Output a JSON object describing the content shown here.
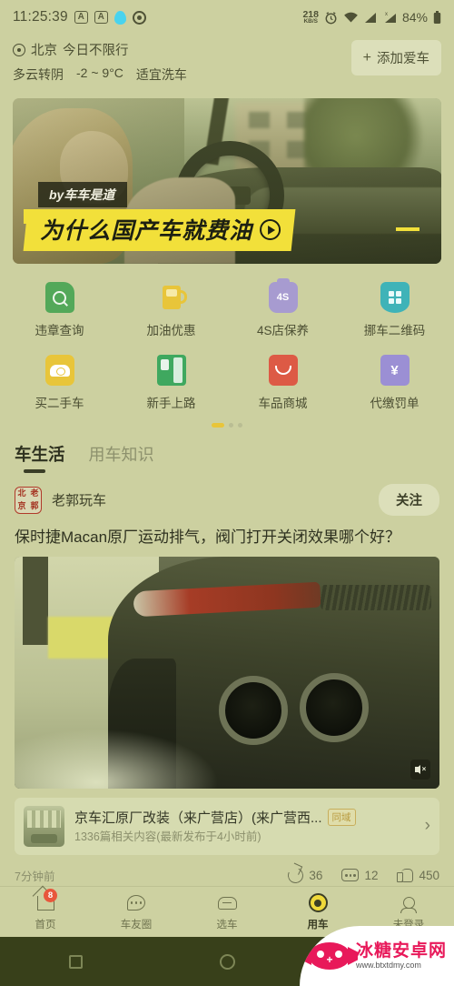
{
  "status_bar": {
    "time": "11:25:39",
    "icons": [
      "android-a-icon",
      "android-a-icon",
      "qq-penguin-icon",
      "target-icon"
    ],
    "net_speed_value": "218",
    "net_speed_unit": "KB/S",
    "alarm_icon": "alarm-icon",
    "wifi_icon": "wifi-icon",
    "signal_icon_1": "signal-bars-icon",
    "signal_icon_2": "signal-bars-x-icon",
    "battery_percent": "84%",
    "battery_icon": "battery-icon"
  },
  "header": {
    "location_icon": "location-pin-icon",
    "city": "北京",
    "restriction": "今日不限行",
    "weather": "多云转阴",
    "temperature": "-2 ~ 9°C",
    "wash_advice": "适宜洗车",
    "add_car_label": "添加爱车",
    "add_car_plus": "+"
  },
  "hero": {
    "byline": "by车车是道",
    "title": "为什么国产车就费油",
    "play_icon": "play-circle-icon"
  },
  "grid": {
    "items": [
      {
        "label": "违章查询",
        "icon": "violation-search-icon",
        "color": "#53a859"
      },
      {
        "label": "加油优惠",
        "icon": "fuel-pump-icon",
        "color": "#e8c53a"
      },
      {
        "label": "4S店保养",
        "icon": "4s-maintenance-icon",
        "color": "#a79bd0",
        "badge_text": "4S"
      },
      {
        "label": "挪车二维码",
        "icon": "qr-shield-icon",
        "color": "#3fb3b8"
      },
      {
        "label": "买二手车",
        "icon": "used-car-icon",
        "color": "#e8c53a"
      },
      {
        "label": "新手上路",
        "icon": "beginner-book-icon",
        "color": "#3fa85f"
      },
      {
        "label": "车品商城",
        "icon": "shopping-bag-icon",
        "color": "#dd5a45"
      },
      {
        "label": "代缴罚单",
        "icon": "pay-ticket-icon",
        "color": "#9b8fd4"
      }
    ],
    "pager": {
      "total": 3,
      "active": 0,
      "active_color": "#e8c53a"
    }
  },
  "tabs": [
    {
      "label": "车生活",
      "active": true
    },
    {
      "label": "用车知识",
      "active": false
    }
  ],
  "feed": {
    "author_name": "老郭玩车",
    "avatar_text": [
      "北",
      "老",
      "京",
      "郭"
    ],
    "follow_label": "关注",
    "article_title": "保时捷Macan原厂运动排气，阀门打开关闭效果哪个好？",
    "media_mute_icon": "mute-icon",
    "shop": {
      "name": "京车汇原厂改装（来广营店）(来广营西...",
      "badge": "同域",
      "subtitle": "1336篇相关内容(最新发布于4小时前)",
      "chevron_icon": "chevron-right-icon"
    },
    "time_ago": "7分钟前",
    "actions": [
      {
        "icon": "share-icon",
        "count": "36"
      },
      {
        "icon": "comment-icon",
        "count": "12"
      },
      {
        "icon": "like-icon",
        "count": "450"
      }
    ]
  },
  "bottom_nav": [
    {
      "label": "首页",
      "icon": "home-icon",
      "badge": "8",
      "active": false
    },
    {
      "label": "车友圈",
      "icon": "chat-bubble-icon",
      "active": false
    },
    {
      "label": "选车",
      "icon": "car-icon",
      "active": false
    },
    {
      "label": "用车",
      "icon": "steering-wheel-icon",
      "active": true
    },
    {
      "label": "未登录",
      "icon": "user-icon",
      "active": false
    }
  ],
  "system_nav": [
    {
      "icon": "recents-square-icon"
    },
    {
      "icon": "home-circle-icon"
    },
    {
      "icon": "back-triangle-icon"
    }
  ],
  "watermark": {
    "title": "冰糖安卓网",
    "url": "www.btxtdmy.com",
    "logo_icon": "candy-logo-icon"
  }
}
